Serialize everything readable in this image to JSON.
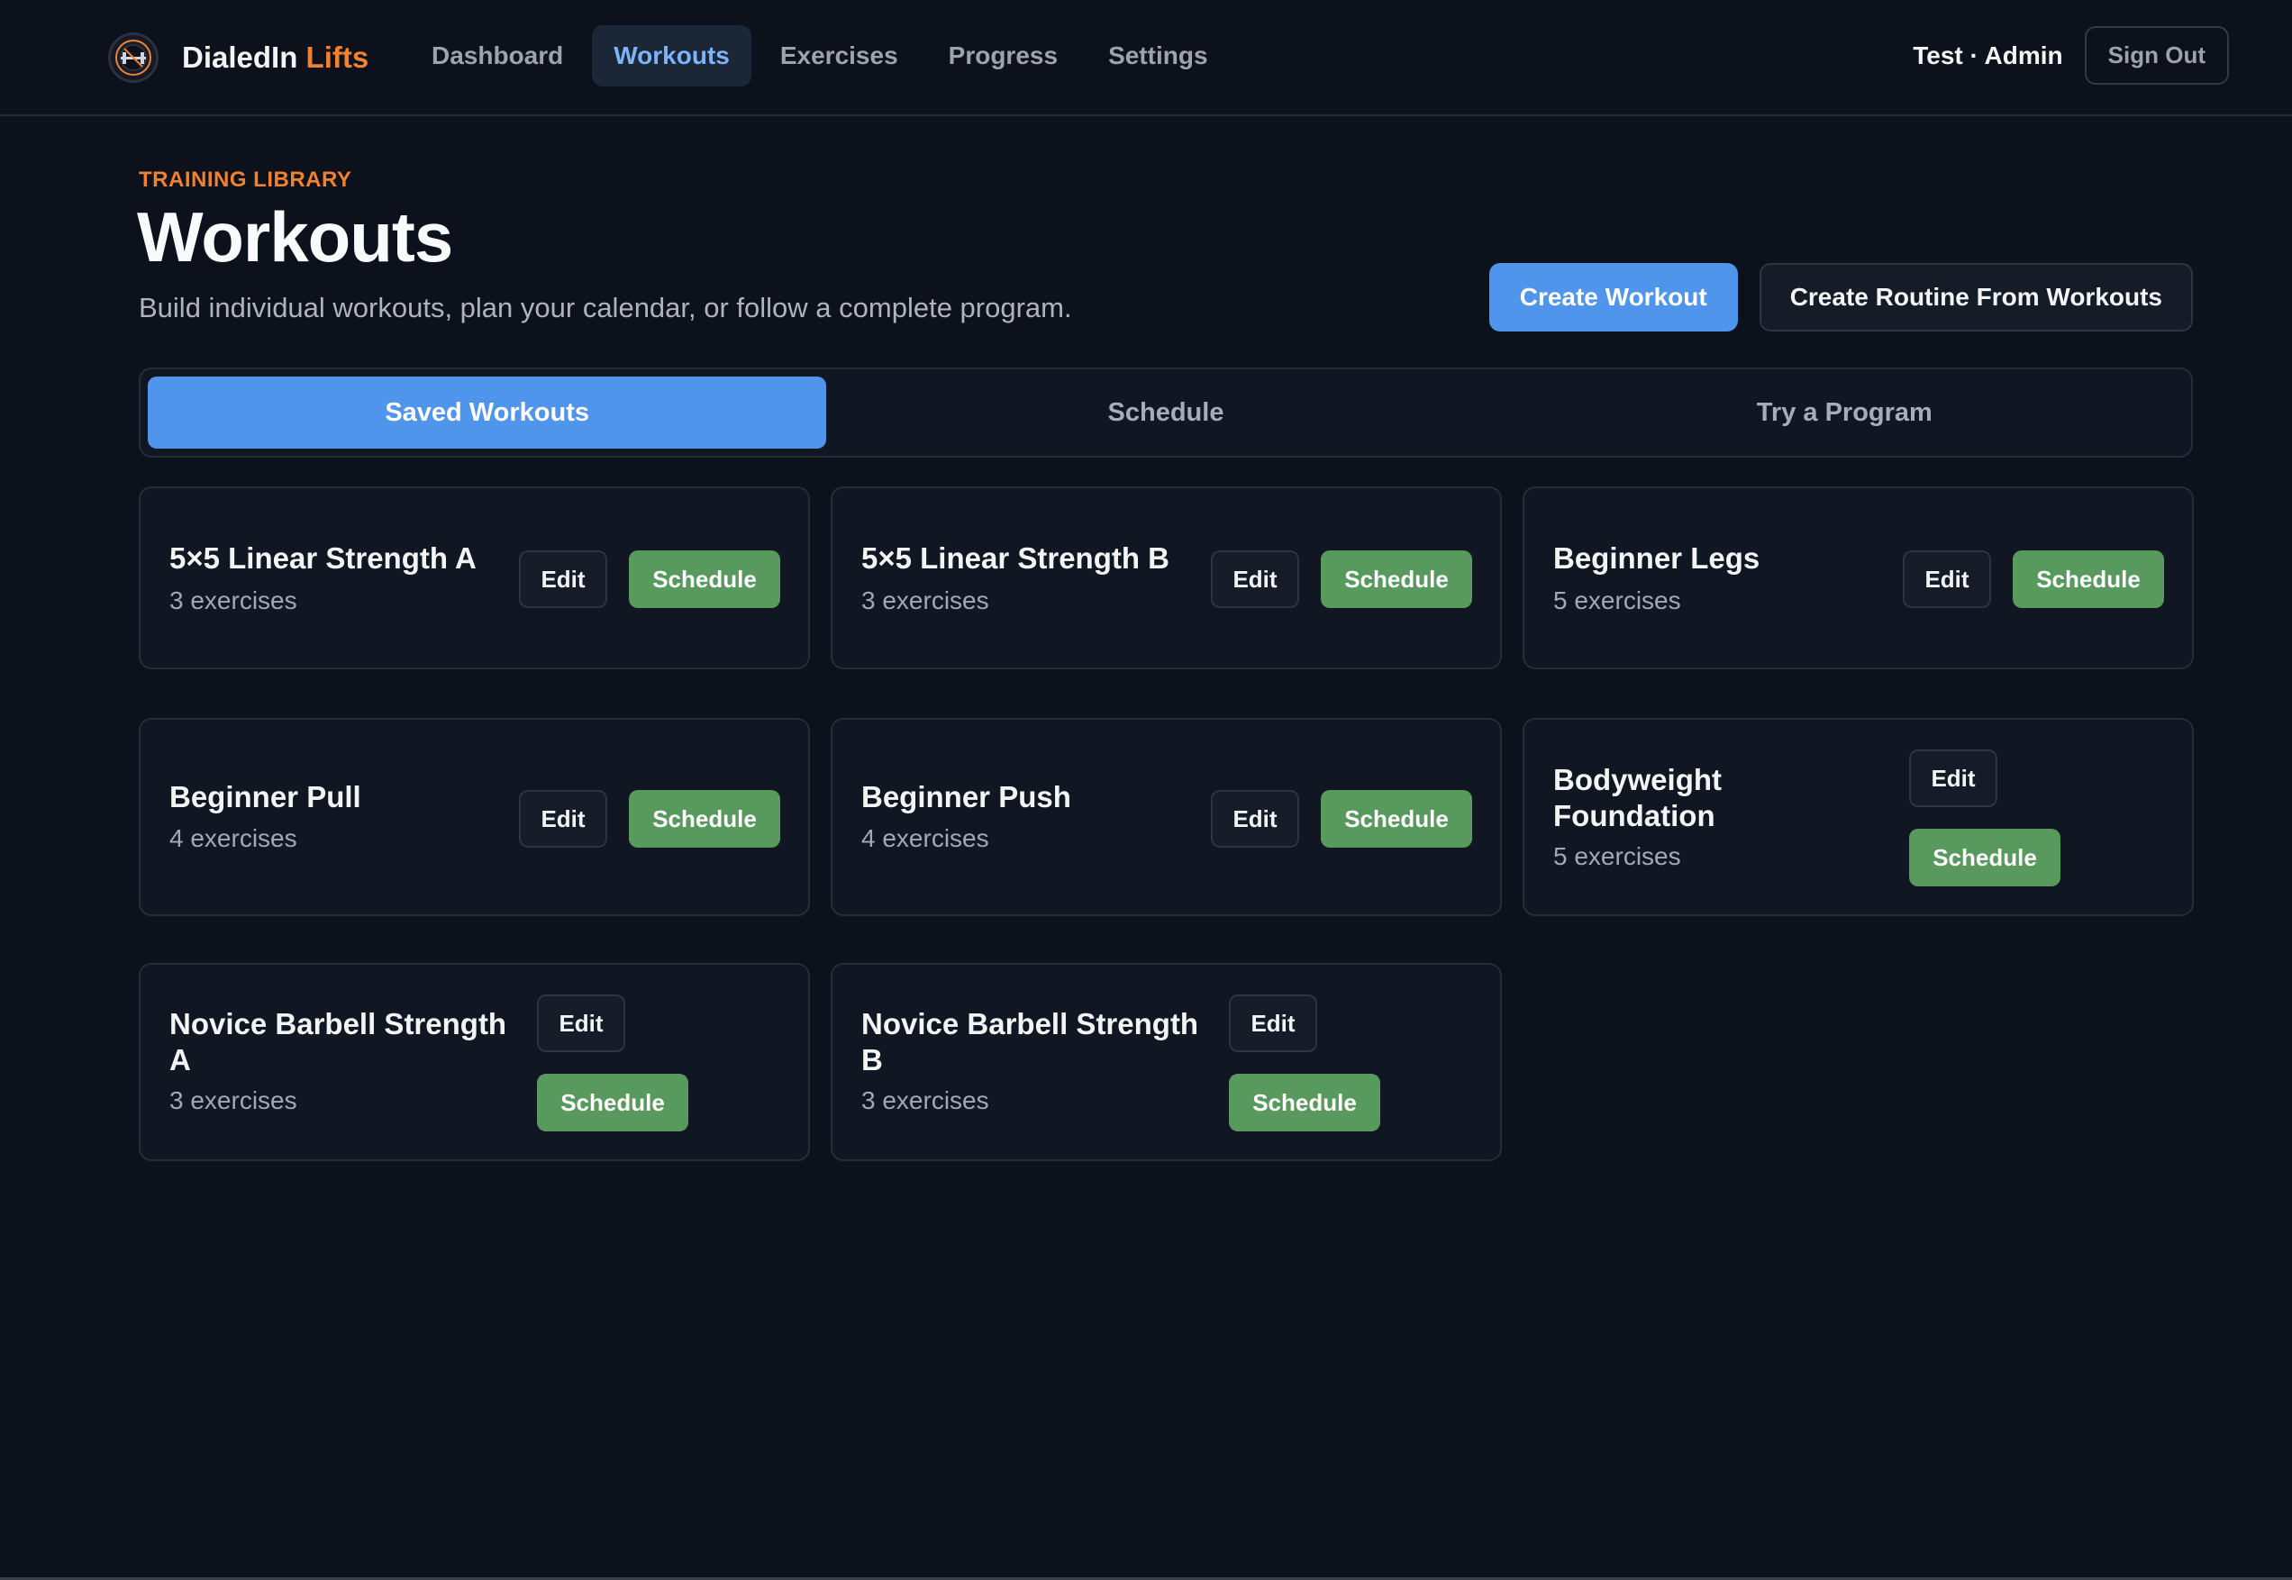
{
  "brand": {
    "name": "DialedIn",
    "accent": "Lifts",
    "accent_color": "#f0822f"
  },
  "nav": {
    "items": [
      {
        "label": "Dashboard"
      },
      {
        "label": "Workouts",
        "active": true
      },
      {
        "label": "Exercises"
      },
      {
        "label": "Progress"
      },
      {
        "label": "Settings"
      }
    ]
  },
  "user": {
    "name": "Test · Admin",
    "sign_out": "Sign Out"
  },
  "header": {
    "eyebrow": "TRAINING LIBRARY",
    "title": "Workouts",
    "subtitle": "Build individual workouts, plan your calendar, or follow a complete program.",
    "create_workout": "Create Workout",
    "create_routine": "Create Routine From Workouts"
  },
  "tabs": [
    {
      "label": "Saved Workouts",
      "active": true
    },
    {
      "label": "Schedule"
    },
    {
      "label": "Try a Program"
    }
  ],
  "workouts": [
    {
      "title": "5×5 Linear Strength A",
      "sub": "3 exercises",
      "edit": "Edit",
      "schedule": "Schedule"
    },
    {
      "title": "5×5 Linear Strength B",
      "sub": "3 exercises",
      "edit": "Edit",
      "schedule": "Schedule"
    },
    {
      "title": "Beginner Legs",
      "sub": "5 exercises",
      "edit": "Edit",
      "schedule": "Schedule"
    },
    {
      "title": "Beginner Pull",
      "sub": "4 exercises",
      "edit": "Edit",
      "schedule": "Schedule"
    },
    {
      "title": "Beginner Push",
      "sub": "4 exercises",
      "edit": "Edit",
      "schedule": "Schedule"
    },
    {
      "title": "Bodyweight Foundation",
      "sub": "5 exercises",
      "edit": "Edit",
      "schedule": "Schedule"
    },
    {
      "title": "Novice Barbell Strength A",
      "sub": "3 exercises",
      "edit": "Edit",
      "schedule": "Schedule"
    },
    {
      "title": "Novice Barbell Strength B",
      "sub": "3 exercises",
      "edit": "Edit",
      "schedule": "Schedule"
    }
  ],
  "colors": {
    "background": "#0d111b",
    "primary": "#4f95ec",
    "schedule_green": "#58995e",
    "nav_active_text": "#7db4f7"
  },
  "icons": {
    "logo": "barbell-logo-icon"
  }
}
